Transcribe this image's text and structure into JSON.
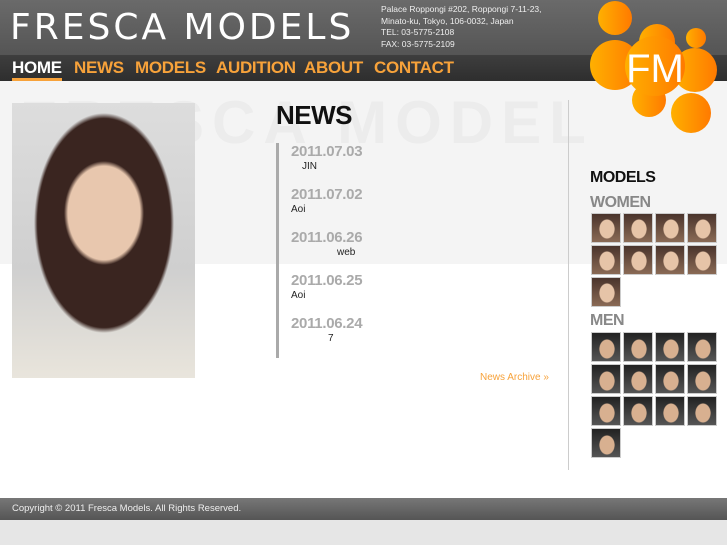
{
  "header": {
    "logo": "FRESCA MODELS",
    "logo_mark": "FM",
    "address": [
      "Palace Roppongi #202, Roppongi 7-11-23,",
      "Minato-ku, Tokyo, 106-0032, Japan",
      "TEL: 03-5775-2108",
      "FAX: 03-5775-2109"
    ]
  },
  "nav": [
    {
      "label": "HOME",
      "active": true
    },
    {
      "label": "NEWS"
    },
    {
      "label": "MODELS"
    },
    {
      "label": "AUDITION"
    },
    {
      "label": "ABOUT"
    },
    {
      "label": "CONTACT"
    }
  ],
  "news": {
    "title": "NEWS",
    "items": [
      {
        "date": "2011.07.03",
        "text": "JIN"
      },
      {
        "date": "2011.07.02",
        "text": "Aoi"
      },
      {
        "date": "2011.06.26",
        "text": "web"
      },
      {
        "date": "2011.06.25",
        "text": "Aoi"
      },
      {
        "date": "2011.06.24",
        "text": "7"
      }
    ],
    "archive": "News Archive »"
  },
  "models": {
    "title": "MODELS",
    "women": {
      "label": "WOMEN",
      "count": 9
    },
    "men": {
      "label": "MEN",
      "count": 13
    }
  },
  "footer": {
    "copyright": "Copyright © 2011 Fresca Models. All Rights Reserved."
  },
  "colors": {
    "accent": "#f7a23a"
  }
}
